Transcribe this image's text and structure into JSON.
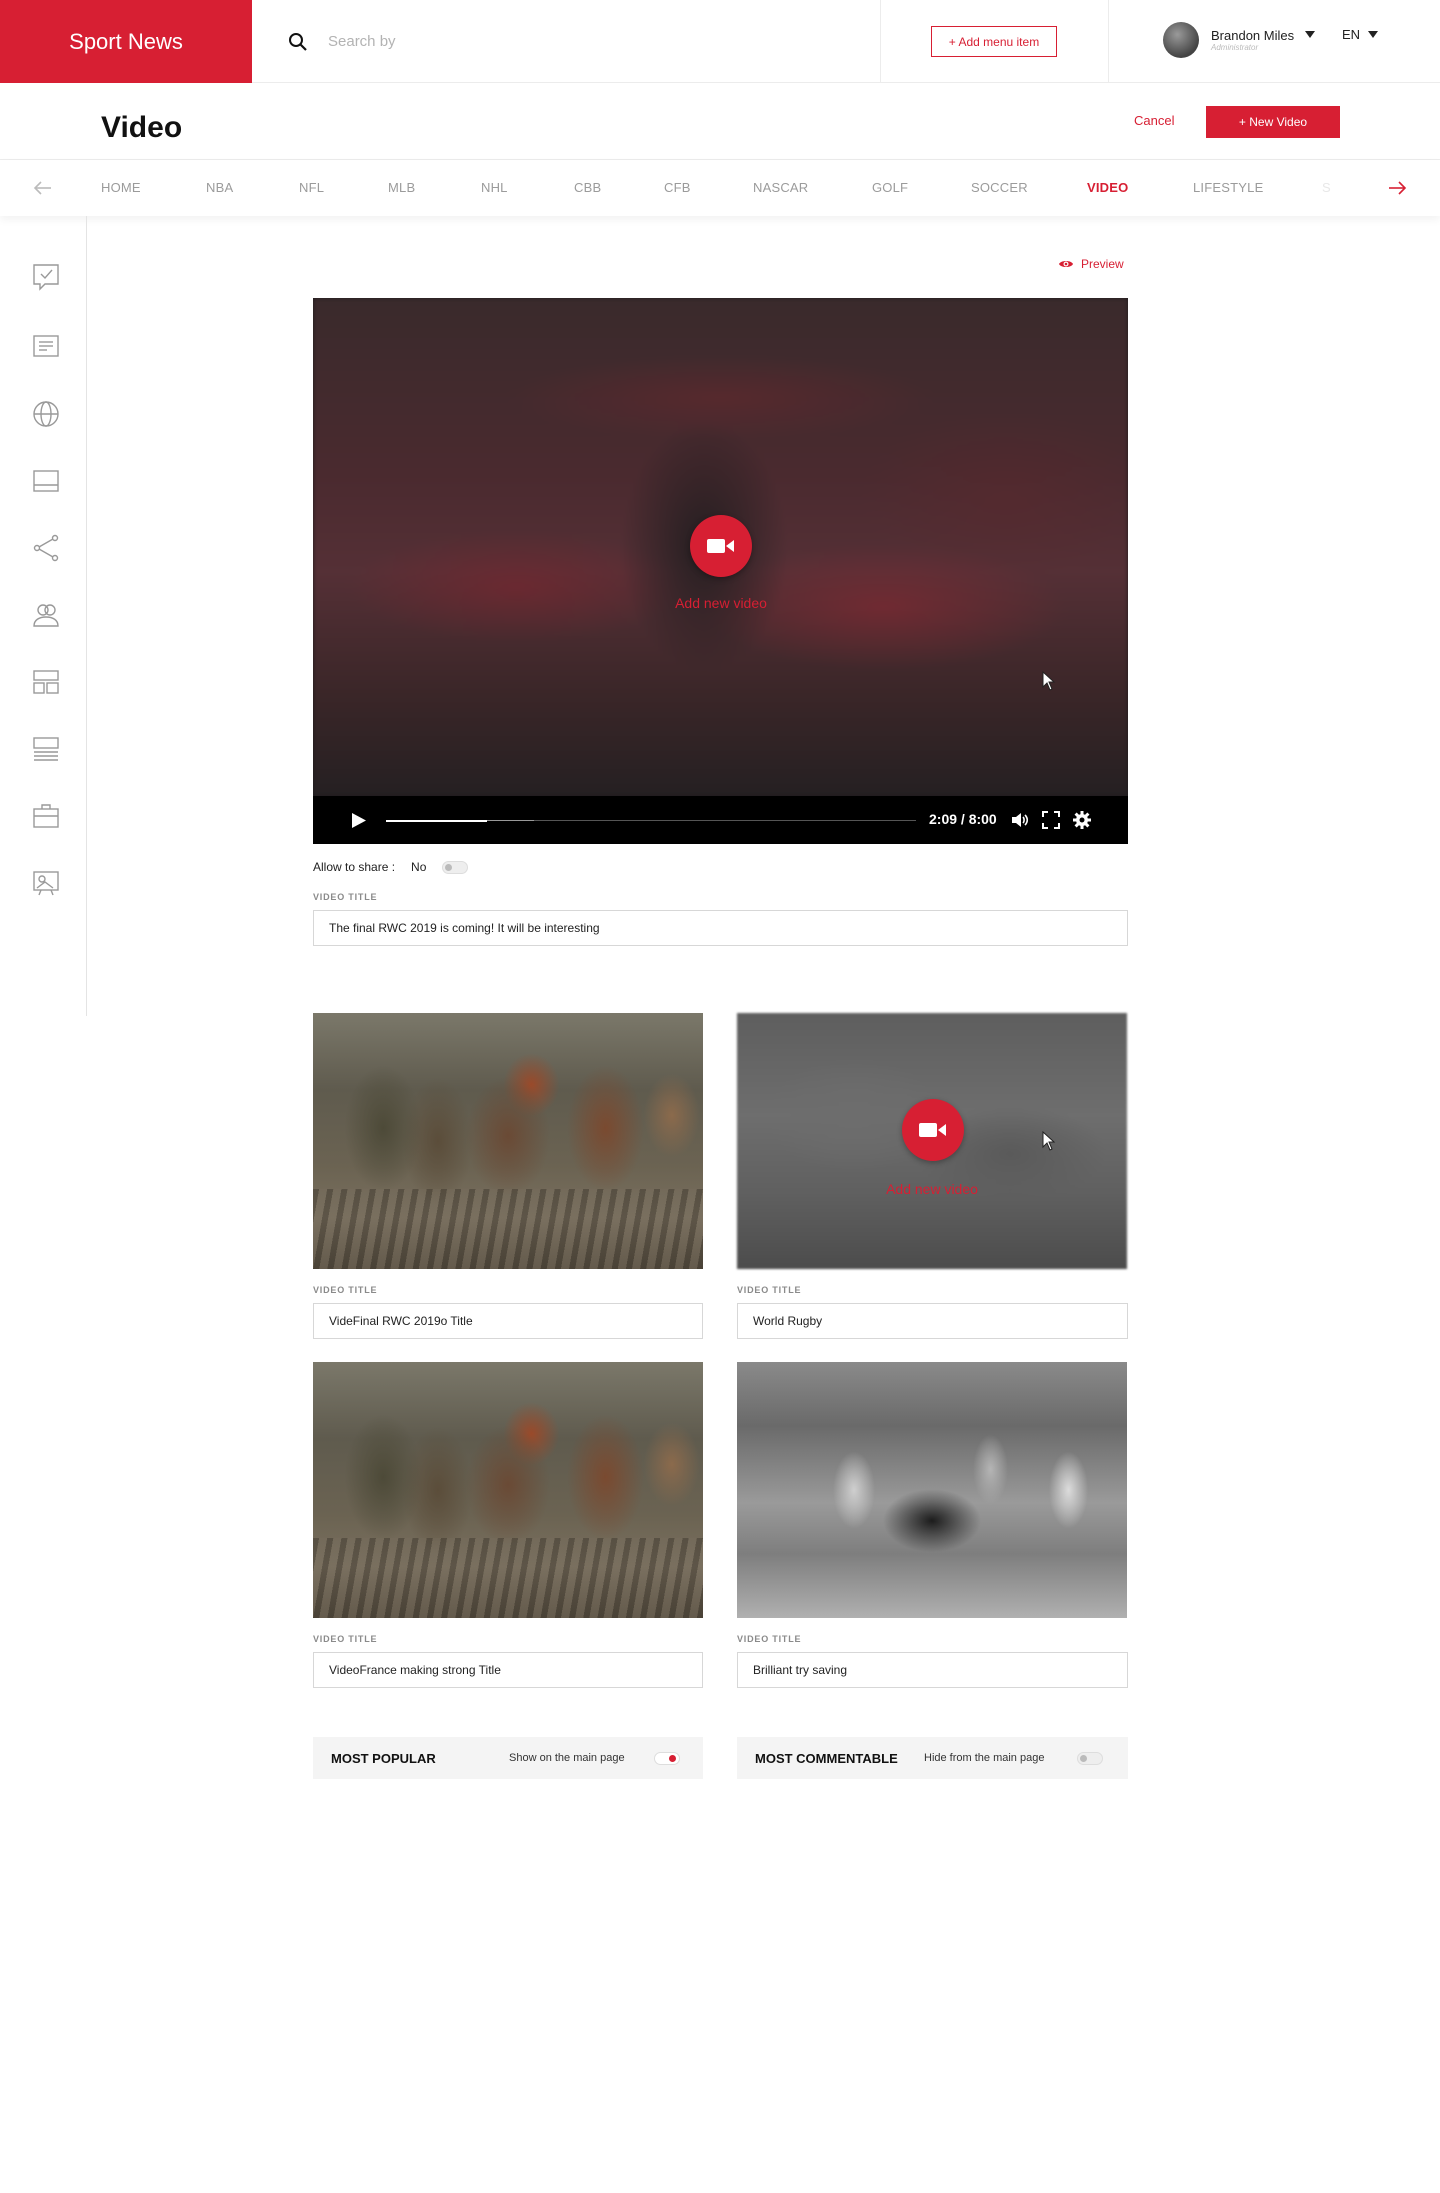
{
  "brand": {
    "name": "Sport News",
    "color": "#d71f33"
  },
  "search": {
    "placeholder": "Search by",
    "icon": "search-icon"
  },
  "header": {
    "add_menu_label": "+ Add menu item"
  },
  "user": {
    "name": "Brandon Miles",
    "role": "Administrator"
  },
  "language": {
    "current": "EN"
  },
  "page": {
    "title": "Video",
    "cancel_label": "Cancel",
    "new_video_label": "+ New Video"
  },
  "nav": {
    "items": [
      "HOME",
      "NBA",
      "NFL",
      "MLB",
      "NHL",
      "CBB",
      "CFB",
      "NASCAR",
      "GOLF",
      "SOCCER",
      "VIDEO",
      "LIFESTYLE"
    ],
    "active": "VIDEO"
  },
  "sidebar": {
    "icons": [
      "checklist-icon",
      "article-icon",
      "globe-icon",
      "layout-icon",
      "share-icon",
      "users-icon",
      "grid-icon",
      "list-icon",
      "briefcase-icon",
      "gallery-icon"
    ]
  },
  "preview": {
    "label": "Preview"
  },
  "main_video": {
    "add_label": "Add new video",
    "time": "2:09 / 8:00",
    "progress_fraction": 0.19,
    "buffer_fraction": 0.28
  },
  "share": {
    "label": "Allow to share :",
    "value": "No",
    "enabled": false
  },
  "main_title": {
    "label": "VIDEO TITLE",
    "value": "The final RWC 2019  is coming! It will be interesting"
  },
  "grid": [
    {
      "label": "VIDEO TITLE",
      "value": "VideFinal RWC 2019o Title",
      "image": "mud-rugby-photo"
    },
    {
      "label": "VIDEO TITLE",
      "value": "World Rugby",
      "image": "blurred-placeholder",
      "add_label": "Add new video"
    },
    {
      "label": "VIDEO TITLE",
      "value": "VideoFrance making strong Title",
      "image": "mud-rugby-photo"
    },
    {
      "label": "VIDEO TITLE",
      "value": "Brilliant try saving",
      "image": "bw-rugby-photo"
    }
  ],
  "sections": [
    {
      "title": "MOST POPULAR",
      "toggle_label": "Show on the main page",
      "enabled": true
    },
    {
      "title": "MOST COMMENTABLE",
      "toggle_label": "Hide from the main page",
      "enabled": false
    }
  ]
}
